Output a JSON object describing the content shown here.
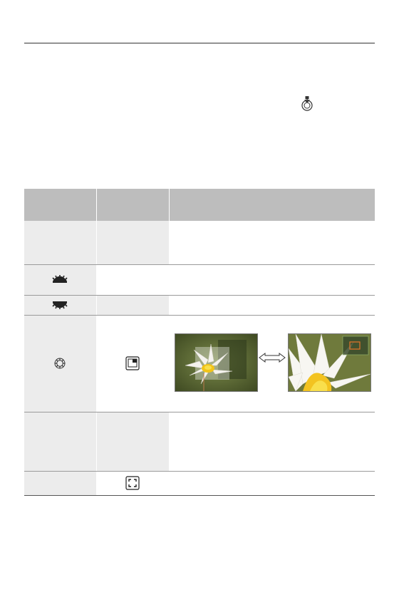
{
  "page": {
    "header_rule": true
  },
  "icons": {
    "joystick": "joystick-press-icon",
    "front_dial": "front-dial-icon",
    "rear_dial": "rear-dial-icon",
    "control_dial": "control-dial-icon",
    "pip_display": "picture-in-picture-icon",
    "full_frame": "full-frame-icon"
  },
  "table": {
    "header": [
      "",
      "",
      ""
    ],
    "rows": [
      {
        "control_icon": "",
        "display_icon": "",
        "text": ""
      },
      {
        "control_icon": "front-dial-icon",
        "display_icon": "",
        "text": ""
      },
      {
        "control_icon": "rear-dial-icon",
        "display_icon": "",
        "text": ""
      },
      {
        "control_icon": "control-dial-icon",
        "display_icon": "picture-in-picture-icon",
        "text": ""
      },
      {
        "control_icon": "",
        "display_icon": "",
        "text": ""
      },
      {
        "control_icon": "",
        "display_icon": "full-frame-icon",
        "text": ""
      }
    ]
  },
  "colors": {
    "header_bg": "#bdbdbd",
    "cell_bg": "#ececec",
    "rule": "#333333"
  }
}
